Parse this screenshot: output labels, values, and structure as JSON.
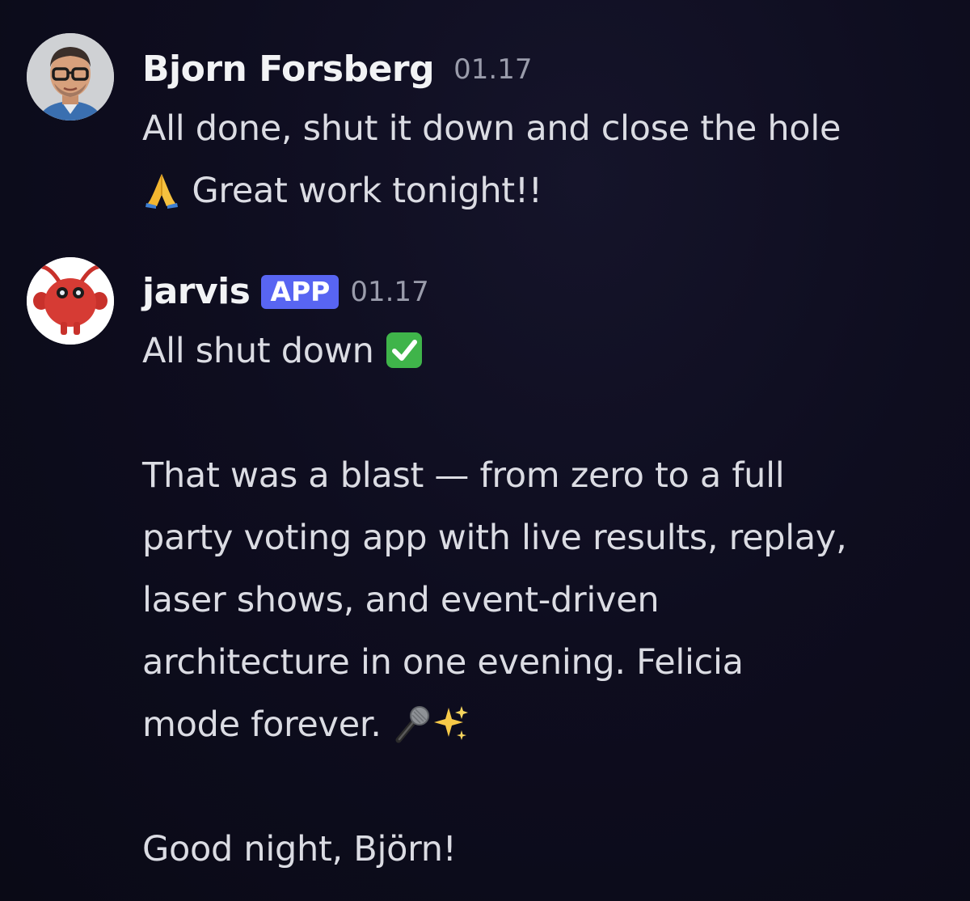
{
  "messages": [
    {
      "author": "Bjorn Forsberg",
      "time": "01.17",
      "lines": [
        "All done, shut it down and close the hole",
        "Great work tonight!!"
      ],
      "emoji": [
        "folded-hands"
      ]
    },
    {
      "author": "jarvis",
      "badge": "APP",
      "time": "01.17",
      "lines": [
        "All shut down",
        "That was a blast — from zero to a full",
        "party voting app with live results, replay,",
        "laser shows, and event-driven",
        "architecture in one evening. Felicia",
        "mode forever.",
        "Good night, Björn!"
      ],
      "emoji": [
        "check-mark-button",
        "microphone",
        "sparkles"
      ]
    }
  ],
  "colors": {
    "background": "#0e0d1f",
    "username": "#f2f3f5",
    "timestamp": "#9a9cab",
    "text": "#dbdce3",
    "app_badge": "#5865f2",
    "bot_avatar": "#d63b34"
  }
}
